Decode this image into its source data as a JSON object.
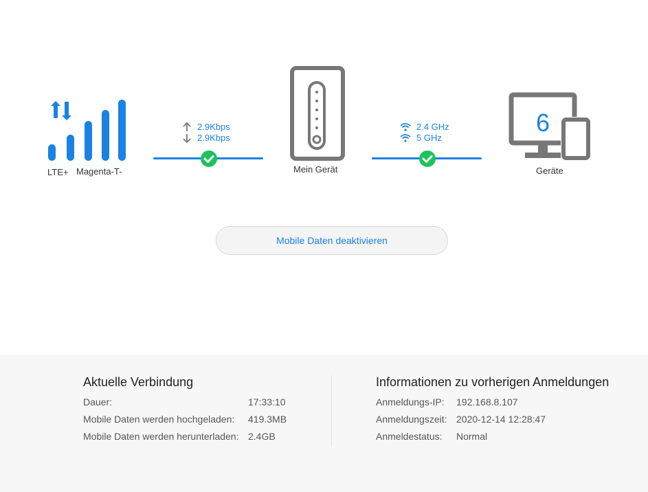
{
  "status": {
    "network_type": "LTE+",
    "carrier": "Magenta-T-",
    "upload_rate": "2.9Kbps",
    "download_rate": "2.9Kbps",
    "router_label": "Mein Gerät",
    "band_24": "2.4 GHz",
    "band_5": "5 GHz",
    "device_count": "6",
    "devices_label": "Geräte",
    "signal_bars": 4,
    "accent_color": "#1a82e2",
    "ok_color": "#1dc35a"
  },
  "actions": {
    "mobile_data_label": "Mobile Daten deaktivieren"
  },
  "current_connection": {
    "title": "Aktuelle Verbindung",
    "rows": [
      {
        "label": "Dauer:",
        "value": "17:33:10"
      },
      {
        "label": "Mobile Daten werden hochgeladen:",
        "value": "419.3MB"
      },
      {
        "label": "Mobile Daten werden herunterladen:",
        "value": "2.4GB"
      }
    ]
  },
  "previous_login": {
    "title": "Informationen zu vorherigen Anmeldungen",
    "rows": [
      {
        "label": "Anmeldungs-IP:",
        "value": "192.168.8.107"
      },
      {
        "label": "Anmeldungszeit:",
        "value": "2020-12-14 12:28:47"
      },
      {
        "label": "Anmeldestatus:",
        "value": "Normal"
      }
    ]
  }
}
